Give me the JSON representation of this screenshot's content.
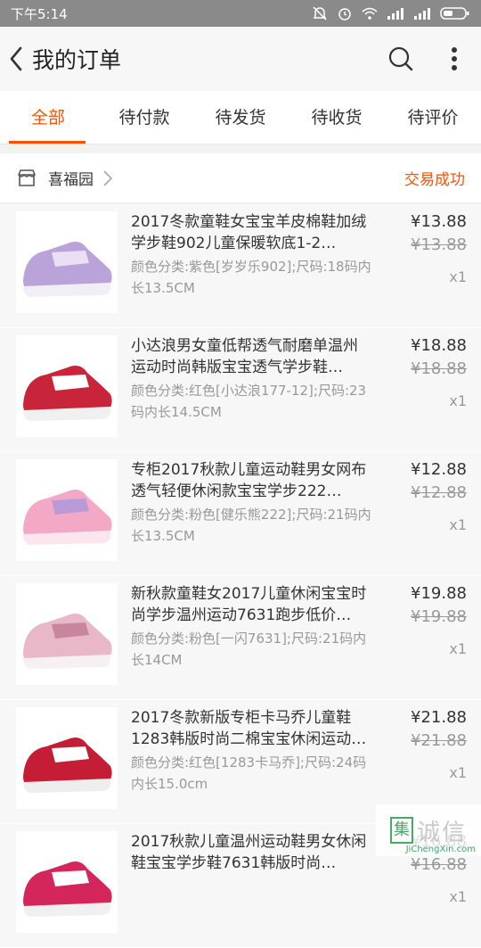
{
  "statusbar": {
    "time": "下午5:14"
  },
  "header": {
    "title": "我的订单"
  },
  "tabs": [
    {
      "label": "全部",
      "active": true
    },
    {
      "label": "待付款",
      "active": false
    },
    {
      "label": "待发货",
      "active": false
    },
    {
      "label": "待收货",
      "active": false
    },
    {
      "label": "待评价",
      "active": false
    }
  ],
  "shop": {
    "name": "喜福园",
    "status": "交易成功"
  },
  "items": [
    {
      "name": "2017冬款童鞋女宝宝羊皮棉鞋加绒学步鞋902儿童保暖软底1-2…",
      "attr": "颜色分类:紫色[岁岁乐902];尺码:18码内长13.5CM",
      "price": "¥13.88",
      "orig": "¥13.88",
      "qty": "x1",
      "color": "#b9a3d8",
      "accent": "#e9e0f3",
      "sole": "#f2eef6"
    },
    {
      "name": "小达浪男女童低帮透气耐磨单温州运动时尚韩版宝宝透气学步鞋…",
      "attr": "颜色分类:红色[小达浪177-12];尺码:23码内长14.5CM",
      "price": "¥18.88",
      "orig": "¥18.88",
      "qty": "x1",
      "color": "#c8243a",
      "accent": "#ffffff",
      "sole": "#f0f0f0"
    },
    {
      "name": "专柜2017秋款儿童运动鞋男女网布透气轻便休闲款宝宝学步222…",
      "attr": "颜色分类:粉色[健乐熊222];尺码:21码内长13.5CM",
      "price": "¥12.88",
      "orig": "¥12.88",
      "qty": "x1",
      "color": "#f3a9c6",
      "accent": "#b99ad8",
      "sole": "#fbe6ef"
    },
    {
      "name": "新秋款童鞋女2017儿童休闲宝宝时尚学步温州运动7631跑步低价…",
      "attr": "颜色分类:粉色[一闪7631];尺码:21码内长14CM",
      "price": "¥19.88",
      "orig": "¥19.88",
      "qty": "x1",
      "color": "#e9b8c8",
      "accent": "#c9859e",
      "sole": "#f6f0f2"
    },
    {
      "name": "2017冬款新版专柜卡马乔儿童鞋1283韩版时尚二棉宝宝休闲运动…",
      "attr": "颜色分类:红色[1283卡马乔];尺码:24码内长15.0cm",
      "price": "¥21.88",
      "orig": "¥21.88",
      "qty": "x1",
      "color": "#c51d35",
      "accent": "#ffffff",
      "sole": "#eeeeee"
    },
    {
      "name": "2017秋款儿童温州运动鞋男女休闲鞋宝宝学步鞋7631韩版时尚…",
      "attr": "",
      "price": "¥16.88",
      "orig": "¥16.88",
      "qty": "x1",
      "color": "#d4265c",
      "accent": "#ffffff",
      "sole": "#f0f0f0"
    }
  ],
  "watermark": {
    "mark": "集",
    "chars": "诚信",
    "url": "JiChengXin.com"
  }
}
